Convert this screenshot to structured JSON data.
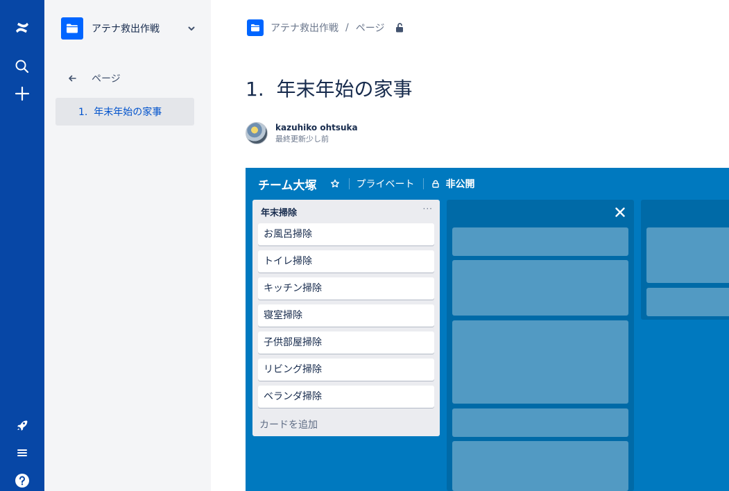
{
  "nav": {
    "logo_icon": "confluence-logo-icon",
    "search_icon": "search-icon",
    "create_icon": "plus-icon",
    "notifications_icon": "rocket-icon",
    "menu_icon": "menu-icon",
    "help_icon": "help-icon",
    "bg_color": "#0747a6"
  },
  "sidebar": {
    "space_name": "アテナ救出作戦",
    "back_label": "ページ",
    "pages": [
      {
        "label": "1.  年末年始の家事"
      }
    ]
  },
  "breadcrumb": {
    "space": "アテナ救出作戦",
    "separator": "/",
    "page": "ページ"
  },
  "page": {
    "title": "1.  年末年始の家事",
    "author": "kazuhiko ohtsuka",
    "updated": "最終更新少し前"
  },
  "board": {
    "name": "チーム大塚",
    "visibility": "プライベート",
    "public_status": "非公開",
    "bg_color": "#0079bf",
    "list": {
      "title": "年末掃除",
      "more": "···",
      "cards": [
        "お風呂掃除",
        "トイレ掃除",
        "キッチン掃除",
        "寝室掃除",
        "子供部屋掃除",
        "リビング掃除",
        "ベランダ掃除"
      ],
      "add_card": "カードを追加"
    }
  }
}
